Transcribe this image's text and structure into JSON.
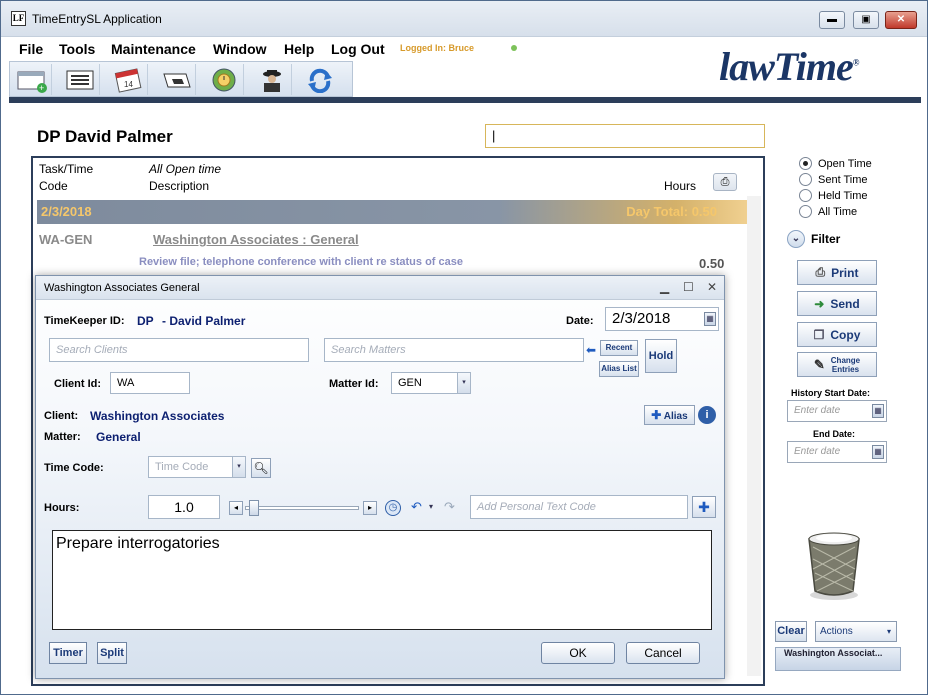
{
  "window": {
    "title": "TimeEntrySL Application",
    "app_icon": "LF",
    "minimize": "▬",
    "maximize": "▣",
    "close": "✕"
  },
  "menu": {
    "items": [
      "File",
      "Tools",
      "Maintenance",
      "Window",
      "Help",
      "Log Out"
    ],
    "logged_in": "Logged In: Bruce"
  },
  "toolbar": {
    "icons": [
      "new-entry-icon",
      "list-icon",
      "calendar-icon",
      "send-icon",
      "clock-globe-icon",
      "spy-icon",
      "refresh-icon"
    ]
  },
  "logo": {
    "text": "lawTime",
    "mark": "®"
  },
  "main": {
    "heading": "DP David Palmer",
    "top_search_value": "|",
    "grid": {
      "col_task": "Task/Time",
      "col_code": "Code",
      "col_filter": "All Open time",
      "col_desc": "Description",
      "col_hours": "Hours",
      "day_date": "2/3/2018",
      "day_total": "Day Total: 0.50",
      "entry_code": "WA-GEN",
      "entry_matter": "Washington Associates : General",
      "entry_desc": "Review file; telephone conference with client re status of case",
      "entry_hours": "0.50"
    }
  },
  "right": {
    "radios": [
      {
        "label": "Open Time",
        "selected": true
      },
      {
        "label": "Sent Time",
        "selected": false
      },
      {
        "label": "Held Time",
        "selected": false
      },
      {
        "label": "All Time",
        "selected": false
      }
    ],
    "filter": "Filter",
    "print": "Print",
    "send": "Send",
    "copy": "Copy",
    "change_entries_1": "Change",
    "change_entries_2": "Entries",
    "history_start": "History Start Date:",
    "end_date": "End Date:",
    "date_placeholder": "Enter date",
    "clear": "Clear",
    "actions": "Actions",
    "tab_strip": "Washington Associat..."
  },
  "dialog": {
    "title": "Washington Associates General",
    "timekeeper_label": "TimeKeeper ID:",
    "timekeeper_code": "DP",
    "timekeeper_name": "- David Palmer",
    "date_label": "Date:",
    "date_value": "2/3/2018",
    "search_clients_ph": "Search Clients",
    "search_matters_ph": "Search Matters",
    "recent": "Recent",
    "alias_list": "Alias List",
    "hold": "Hold",
    "client_id_label": "Client Id:",
    "client_id_value": "WA",
    "matter_id_label": "Matter Id:",
    "matter_id_value": "GEN",
    "client_label": "Client:",
    "client_value": "Washington Associates",
    "matter_label": "Matter:",
    "matter_value": "General",
    "alias_btn": "Alias",
    "time_code_label": "Time Code:",
    "time_code_ph": "Time Code",
    "hours_label": "Hours:",
    "hours_value": "1.0",
    "personal_text_ph": "Add Personal Text Code",
    "description": "Prepare interrogatories",
    "timer": "Timer",
    "split": "Split",
    "ok": "OK",
    "cancel": "Cancel"
  }
}
